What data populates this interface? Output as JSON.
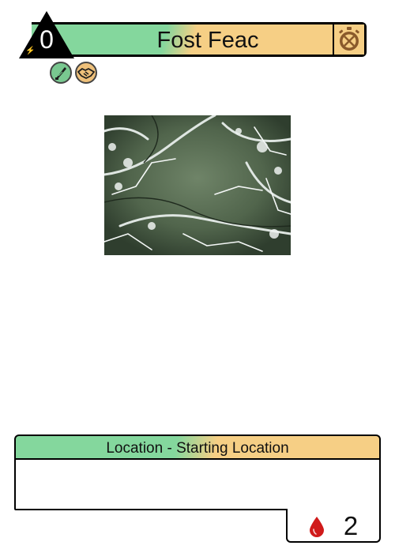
{
  "card": {
    "title": "Fost Feac",
    "cost": "0",
    "type_line": "Location - Starting Location",
    "rules_text": "",
    "damage": "2"
  },
  "icons": {
    "cost": "lightning-bolt-icon",
    "timer": "stopwatch-icon",
    "traits": [
      "feather-quill-icon",
      "handshake-icon"
    ],
    "damage": "blood-drop-icon"
  },
  "colors": {
    "green": "#84d79d",
    "orange": "#f6cf85",
    "blood": "#d01a1a",
    "brown": "#8a5a2b"
  }
}
